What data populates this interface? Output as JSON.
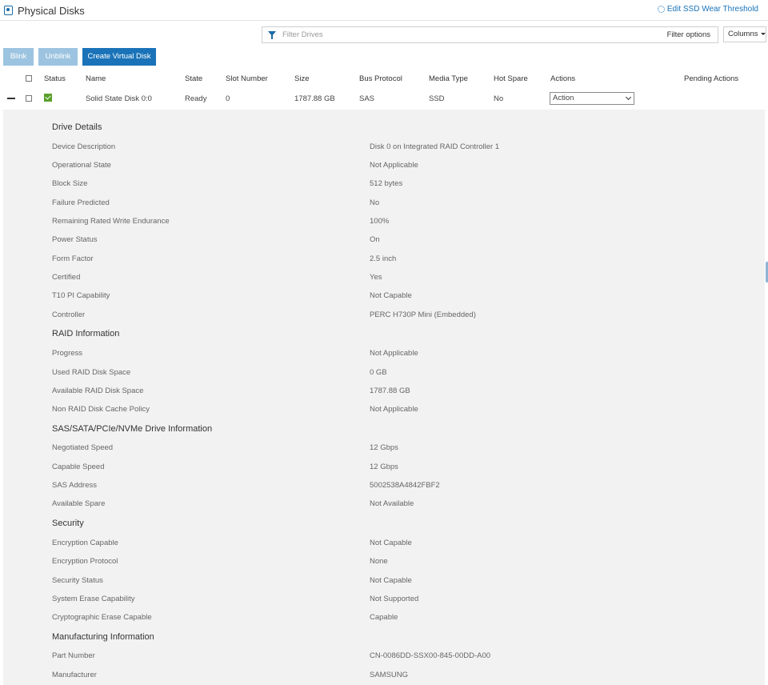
{
  "header": {
    "title": "Physical Disks",
    "edit_link": "Edit SSD Wear Threshold"
  },
  "filter": {
    "placeholder": "Filter Drives",
    "options_label": "Filter options",
    "columns_label": "Columns"
  },
  "toolbar": {
    "blink": "Blink",
    "unblink": "Unblink",
    "create_vd": "Create Virtual Disk"
  },
  "table": {
    "columns": [
      "Status",
      "Name",
      "State",
      "Slot Number",
      "Size",
      "Bus Protocol",
      "Media Type",
      "Hot Spare",
      "Actions",
      "Pending Actions"
    ],
    "row": {
      "name": "Solid State Disk 0:0",
      "state": "Ready",
      "slot": "0",
      "size": "1787.88 GB",
      "bus": "SAS",
      "media": "SSD",
      "hot_spare": "No",
      "action": "Action"
    }
  },
  "details": {
    "drive": {
      "title": "Drive Details",
      "items": [
        {
          "label": "Device Description",
          "value": "Disk 0 on Integrated RAID Controller 1"
        },
        {
          "label": "Operational State",
          "value": "Not Applicable"
        },
        {
          "label": "Block Size",
          "value": "512 bytes"
        },
        {
          "label": "Failure Predicted",
          "value": "No"
        },
        {
          "label": "Remaining Rated Write Endurance",
          "value": "100%"
        },
        {
          "label": "Power Status",
          "value": "On"
        },
        {
          "label": "Form Factor",
          "value": "2.5 inch"
        },
        {
          "label": "Certified",
          "value": "Yes"
        },
        {
          "label": "T10 PI Capability",
          "value": "Not Capable"
        },
        {
          "label": "Controller",
          "value": "PERC H730P Mini (Embedded)"
        }
      ]
    },
    "raid": {
      "title": "RAID Information",
      "items": [
        {
          "label": "Progress",
          "value": "Not Applicable"
        },
        {
          "label": "Used RAID Disk Space",
          "value": "0 GB"
        },
        {
          "label": "Available RAID Disk Space",
          "value": "1787.88 GB"
        },
        {
          "label": "Non RAID Disk Cache Policy",
          "value": "Not Applicable"
        }
      ]
    },
    "bus": {
      "title": "SAS/SATA/PCIe/NVMe Drive Information",
      "items": [
        {
          "label": "Negotiated Speed",
          "value": "12 Gbps"
        },
        {
          "label": "Capable Speed",
          "value": "12 Gbps"
        },
        {
          "label": "SAS Address",
          "value": "5002538A4842FBF2"
        },
        {
          "label": "Available Spare",
          "value": "Not Available"
        }
      ]
    },
    "security": {
      "title": "Security",
      "items": [
        {
          "label": "Encryption Capable",
          "value": "Not Capable"
        },
        {
          "label": "Encryption Protocol",
          "value": "None"
        },
        {
          "label": "Security Status",
          "value": "Not Capable"
        },
        {
          "label": "System Erase Capability",
          "value": "Not Supported"
        },
        {
          "label": "Cryptographic Erase Capable",
          "value": "Capable"
        }
      ]
    },
    "manufacturing": {
      "title": "Manufacturing Information",
      "items": [
        {
          "label": "Part Number",
          "value": "CN-0086DD-SSX00-845-00DD-A00"
        },
        {
          "label": "Manufacturer",
          "value": "SAMSUNG"
        }
      ]
    }
  }
}
